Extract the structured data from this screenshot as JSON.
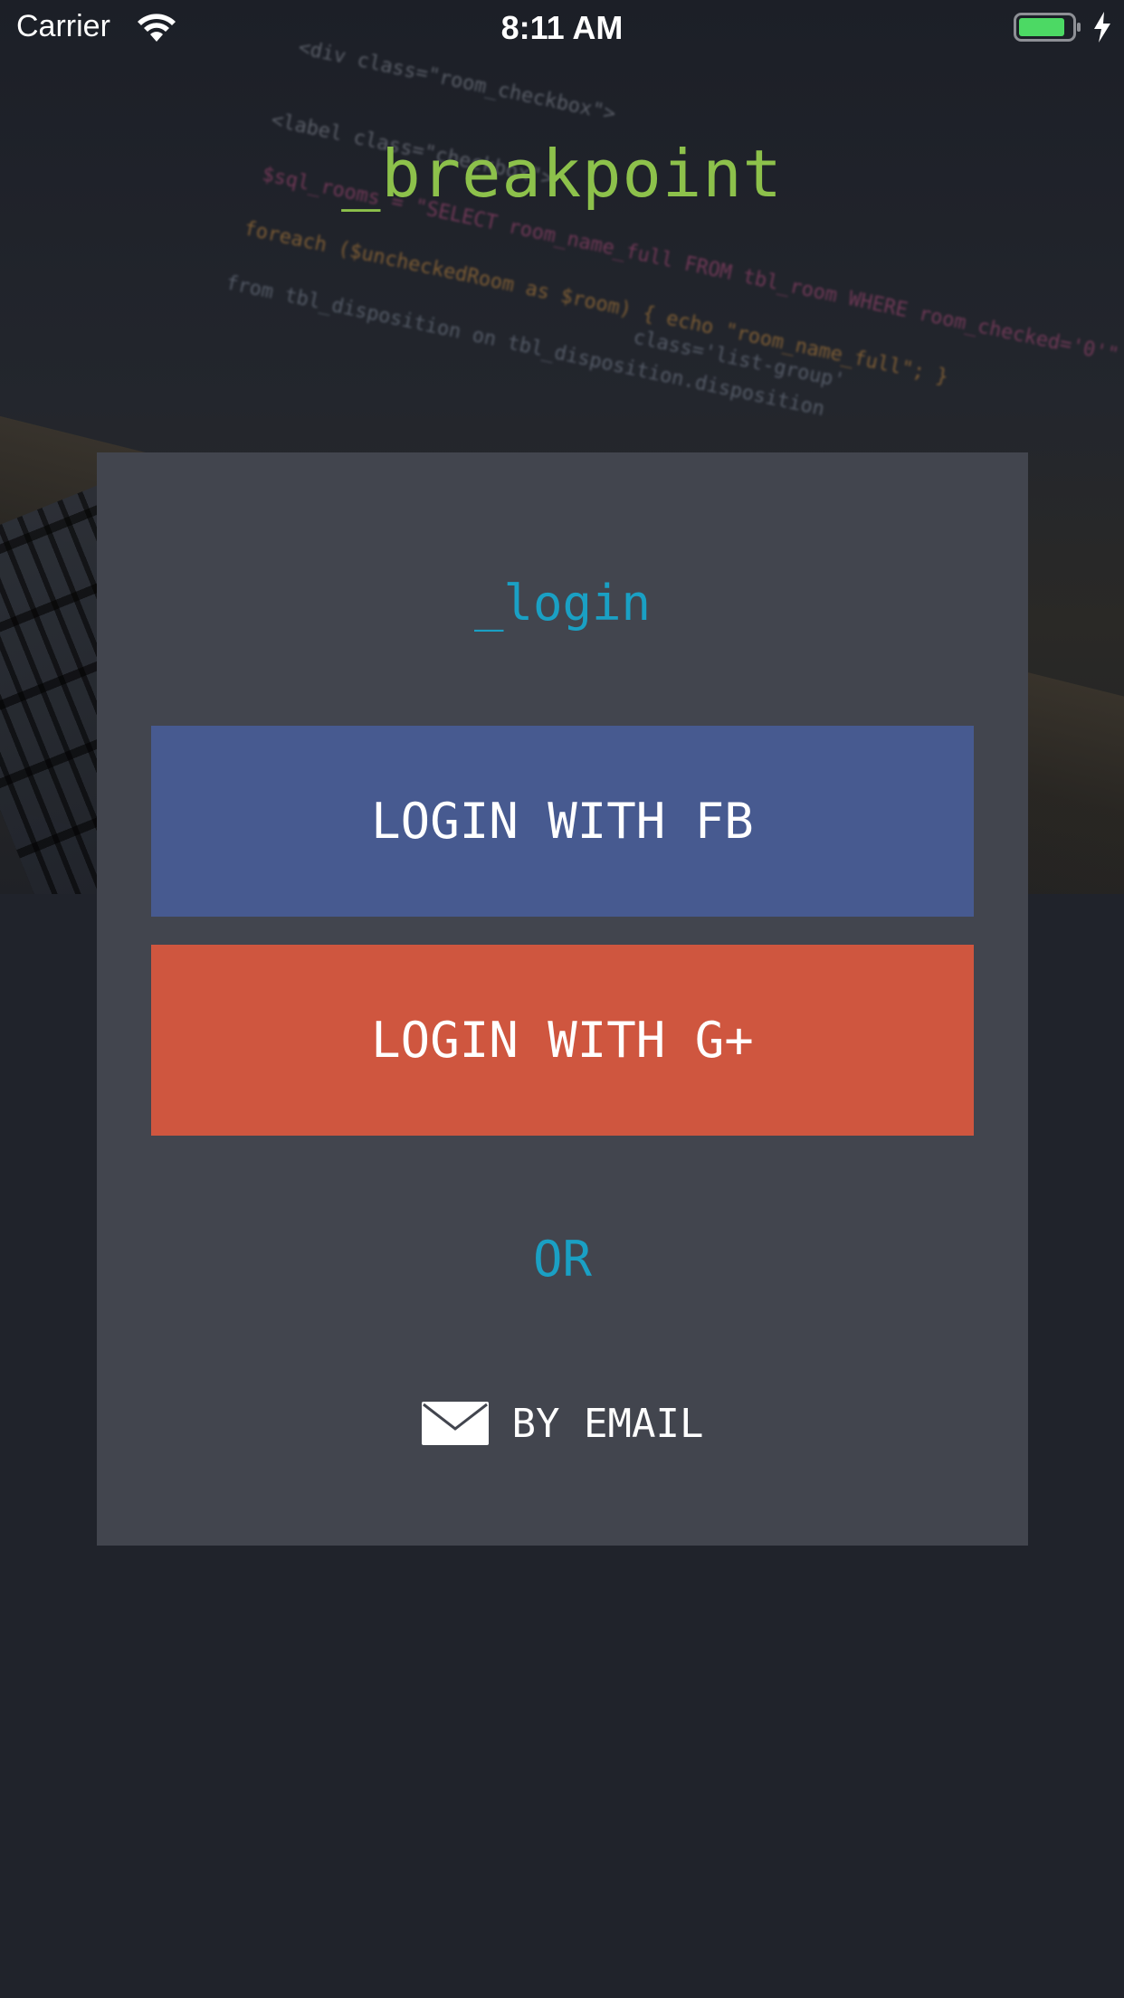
{
  "status_bar": {
    "carrier": "Carrier",
    "time": "8:11 AM",
    "wifi_icon": "wifi-icon",
    "battery_icon": "battery-icon",
    "charging_icon": "charging-bolt-icon"
  },
  "header": {
    "app_title": "_breakpoint"
  },
  "login_card": {
    "heading": "_login",
    "facebook_button": "LOGIN WITH FB",
    "google_button": "LOGIN WITH G+",
    "separator": "OR",
    "email_button": "BY EMAIL",
    "email_icon": "envelope-icon"
  },
  "colors": {
    "background": "#20232b",
    "card": "#42454e",
    "title_green": "#8dc14b",
    "accent_cyan": "#1aa0c4",
    "facebook_blue": "#475a90",
    "google_red": "#cf563f",
    "battery_green": "#4cd964"
  }
}
